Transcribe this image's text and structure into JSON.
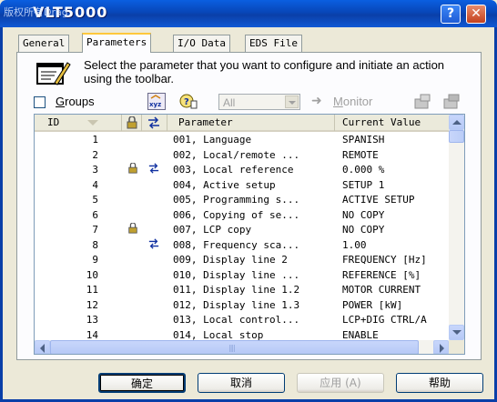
{
  "window": {
    "title": "VLT5000",
    "title_overlay": "版权所有Drag",
    "help_glyph": "?",
    "close_glyph": "✕"
  },
  "tabs": [
    {
      "label": "General",
      "active": false
    },
    {
      "label": "Parameters",
      "active": true
    },
    {
      "label": "I/O Data",
      "active": false
    },
    {
      "label": "EDS File",
      "active": false
    }
  ],
  "info": {
    "text": "Select the parameter that you want to configure and initiate an action using the toolbar."
  },
  "toolbar": {
    "groups_prefix": "G",
    "groups_rest": "roups",
    "groups_checked": false,
    "filter_value": "All",
    "monitor_label": "Monitor",
    "monitor_underline": "M"
  },
  "grid": {
    "columns": [
      "ID",
      "Parameter",
      "Current Value"
    ],
    "rows": [
      {
        "id": "1",
        "lock": false,
        "link": false,
        "param": "001, Language",
        "value": "SPANISH"
      },
      {
        "id": "2",
        "lock": false,
        "link": false,
        "param": "002, Local/remote ...",
        "value": "REMOTE"
      },
      {
        "id": "3",
        "lock": true,
        "link": true,
        "param": "003, Local reference",
        "value": "0.000 %"
      },
      {
        "id": "4",
        "lock": false,
        "link": false,
        "param": "004, Active setup",
        "value": "SETUP 1"
      },
      {
        "id": "5",
        "lock": false,
        "link": false,
        "param": "005, Programming s...",
        "value": "ACTIVE SETUP"
      },
      {
        "id": "6",
        "lock": false,
        "link": false,
        "param": "006, Copying of se...",
        "value": "NO COPY"
      },
      {
        "id": "7",
        "lock": true,
        "link": false,
        "param": "007, LCP copy",
        "value": "NO COPY"
      },
      {
        "id": "8",
        "lock": false,
        "link": true,
        "param": "008, Frequency sca...",
        "value": "1.00"
      },
      {
        "id": "9",
        "lock": false,
        "link": false,
        "param": "009, Display line 2",
        "value": "FREQUENCY [Hz]"
      },
      {
        "id": "10",
        "lock": false,
        "link": false,
        "param": "010, Display line ...",
        "value": "REFERENCE [%]"
      },
      {
        "id": "11",
        "lock": false,
        "link": false,
        "param": "011, Display line 1.2",
        "value": "MOTOR CURRENT"
      },
      {
        "id": "12",
        "lock": false,
        "link": false,
        "param": "012, Display line 1.3",
        "value": "POWER [kW]"
      },
      {
        "id": "13",
        "lock": false,
        "link": false,
        "param": "013, Local control...",
        "value": "LCP+DIG CTRL/A"
      },
      {
        "id": "14",
        "lock": false,
        "link": false,
        "param": "014, Local stop",
        "value": "ENABLE"
      }
    ]
  },
  "buttons": {
    "ok": "确定",
    "cancel": "取消",
    "apply": "应用 (A)",
    "help": "帮助"
  }
}
